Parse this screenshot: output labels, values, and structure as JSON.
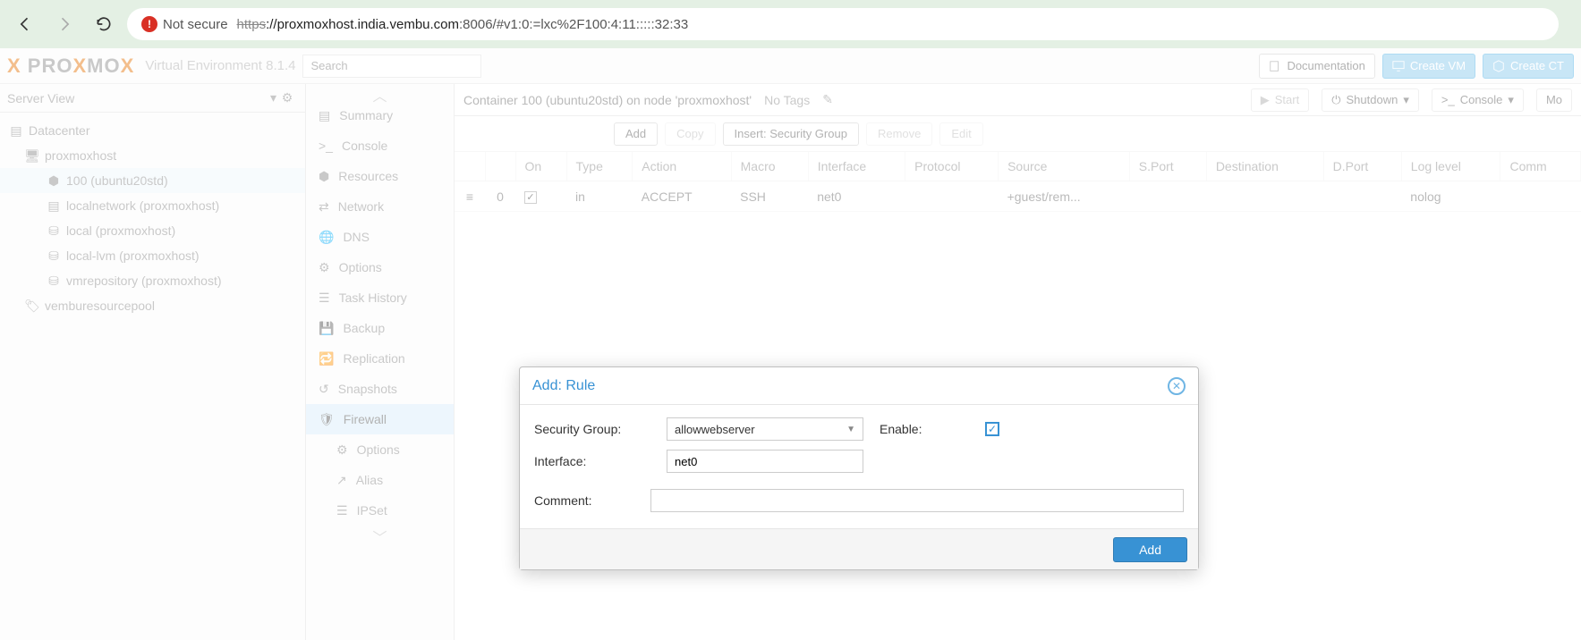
{
  "browser": {
    "not_secure": "Not secure",
    "url_https": "https",
    "url_host": "://proxmoxhost.india.vembu.com",
    "url_path": ":8006/#v1:0:=lxc%2F100:4:11:::::32:33"
  },
  "header": {
    "env": "Virtual Environment 8.1.4",
    "search_placeholder": "Search",
    "doc": "Documentation",
    "create_vm": "Create VM",
    "create_ct": "Create CT"
  },
  "left": {
    "view": "Server View",
    "tree": [
      {
        "label": "Datacenter",
        "depth": 0,
        "icon": "server-icon"
      },
      {
        "label": "proxmoxhost",
        "depth": 1,
        "icon": "node-icon"
      },
      {
        "label": "100 (ubuntu20std)",
        "depth": 2,
        "icon": "lxc-icon",
        "sel": true
      },
      {
        "label": "localnetwork (proxmoxhost)",
        "depth": 2,
        "icon": "sdn-icon"
      },
      {
        "label": "local (proxmoxhost)",
        "depth": 2,
        "icon": "storage-icon"
      },
      {
        "label": "local-lvm (proxmoxhost)",
        "depth": 2,
        "icon": "storage-icon"
      },
      {
        "label": "vmrepository (proxmoxhost)",
        "depth": 2,
        "icon": "storage-icon"
      },
      {
        "label": "vemburesourcepool",
        "depth": 1,
        "icon": "pool-icon"
      }
    ]
  },
  "mid": {
    "items": [
      {
        "label": "Summary",
        "icon": "book-icon"
      },
      {
        "label": "Console",
        "icon": "terminal-icon"
      },
      {
        "label": "Resources",
        "icon": "cube-icon"
      },
      {
        "label": "Network",
        "icon": "exchange-icon"
      },
      {
        "label": "DNS",
        "icon": "globe-icon"
      },
      {
        "label": "Options",
        "icon": "gear-icon"
      },
      {
        "label": "Task History",
        "icon": "list-icon"
      },
      {
        "label": "Backup",
        "icon": "save-icon"
      },
      {
        "label": "Replication",
        "icon": "retweet-icon"
      },
      {
        "label": "Snapshots",
        "icon": "history-icon"
      },
      {
        "label": "Firewall",
        "icon": "shield-icon",
        "active": true
      },
      {
        "label": "Options",
        "icon": "gear-icon",
        "sub": true
      },
      {
        "label": "Alias",
        "icon": "external-icon",
        "sub": true
      },
      {
        "label": "IPSet",
        "icon": "bars-icon",
        "sub": true
      }
    ]
  },
  "content": {
    "title": "Container 100 (ubuntu20std) on node 'proxmoxhost'",
    "no_tags": "No Tags",
    "start": "Start",
    "shutdown": "Shutdown",
    "console": "Console",
    "more": "Mo"
  },
  "toolbar": {
    "add": "Add",
    "copy": "Copy",
    "insert": "Insert: Security Group",
    "remove": "Remove",
    "edit": "Edit"
  },
  "table": {
    "cols": [
      "",
      "",
      "On",
      "Type",
      "Action",
      "Macro",
      "Interface",
      "Protocol",
      "Source",
      "S.Port",
      "Destination",
      "D.Port",
      "Log level",
      "Comm"
    ],
    "rows": [
      {
        "num": "0",
        "on": true,
        "type": "in",
        "action": "ACCEPT",
        "macro": "SSH",
        "iface": "net0",
        "proto": "",
        "source": "+guest/rem...",
        "sport": "",
        "dest": "",
        "dport": "",
        "log": "nolog",
        "comment": ""
      }
    ]
  },
  "modal": {
    "title": "Add: Rule",
    "sg_label": "Security Group:",
    "sg_value": "allowwebserver",
    "iface_label": "Interface:",
    "iface_value": "net0",
    "enable_label": "Enable:",
    "enable_value": true,
    "comment_label": "Comment:",
    "comment_value": "",
    "add_btn": "Add"
  }
}
